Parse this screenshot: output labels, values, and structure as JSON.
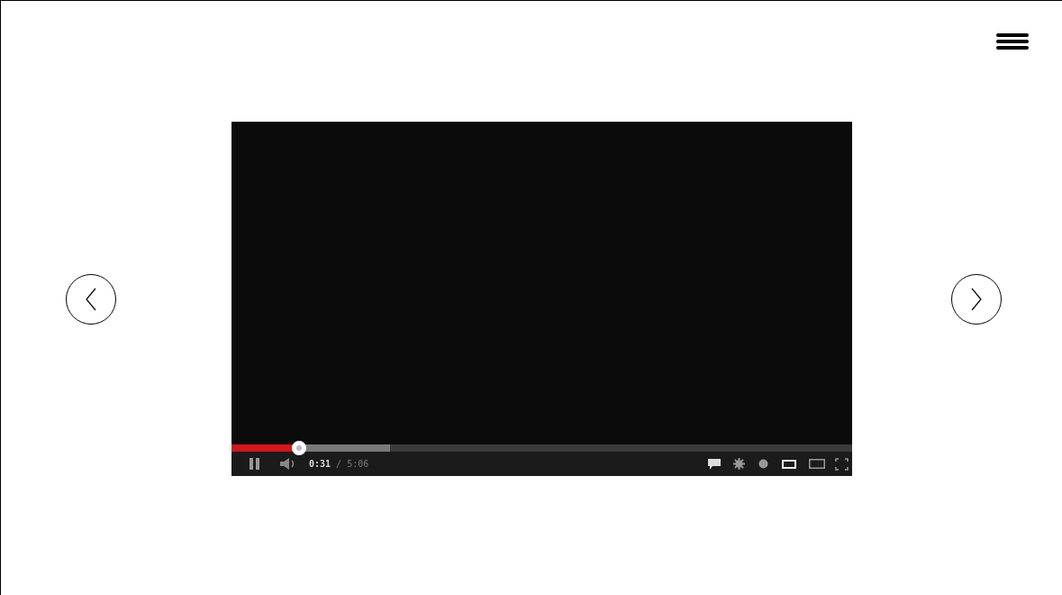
{
  "player": {
    "playing": true,
    "progress": {
      "level": 0.109
    },
    "buffer": {
      "level": 0.255
    },
    "current_time": "0:31",
    "separator": "/",
    "duration": "5:06"
  }
}
